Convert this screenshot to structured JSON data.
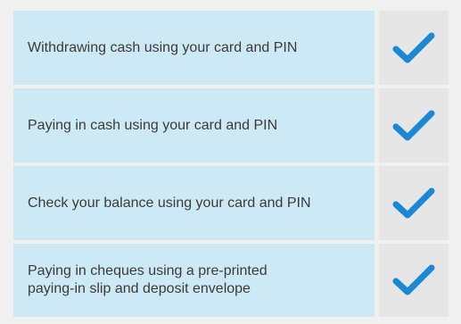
{
  "features": {
    "rows": [
      {
        "label": "Withdrawing cash using your card and PIN",
        "checked": true,
        "check_icon": "check-icon"
      },
      {
        "label": "Paying in cash using your card and PIN",
        "checked": true,
        "check_icon": "check-icon"
      },
      {
        "label": "Check your balance using your card and PIN",
        "checked": true,
        "check_icon": "check-icon"
      },
      {
        "label": "Paying in cheques using a pre-printed\npaying-in slip and deposit envelope",
        "checked": true,
        "check_icon": "check-icon"
      }
    ]
  },
  "colors": {
    "label_background": "#cde9f6",
    "check_background": "#e6e6e6",
    "check_mark": "#1a88d6",
    "text": "#3b3b3b",
    "page_background": "#f0f0f0"
  }
}
